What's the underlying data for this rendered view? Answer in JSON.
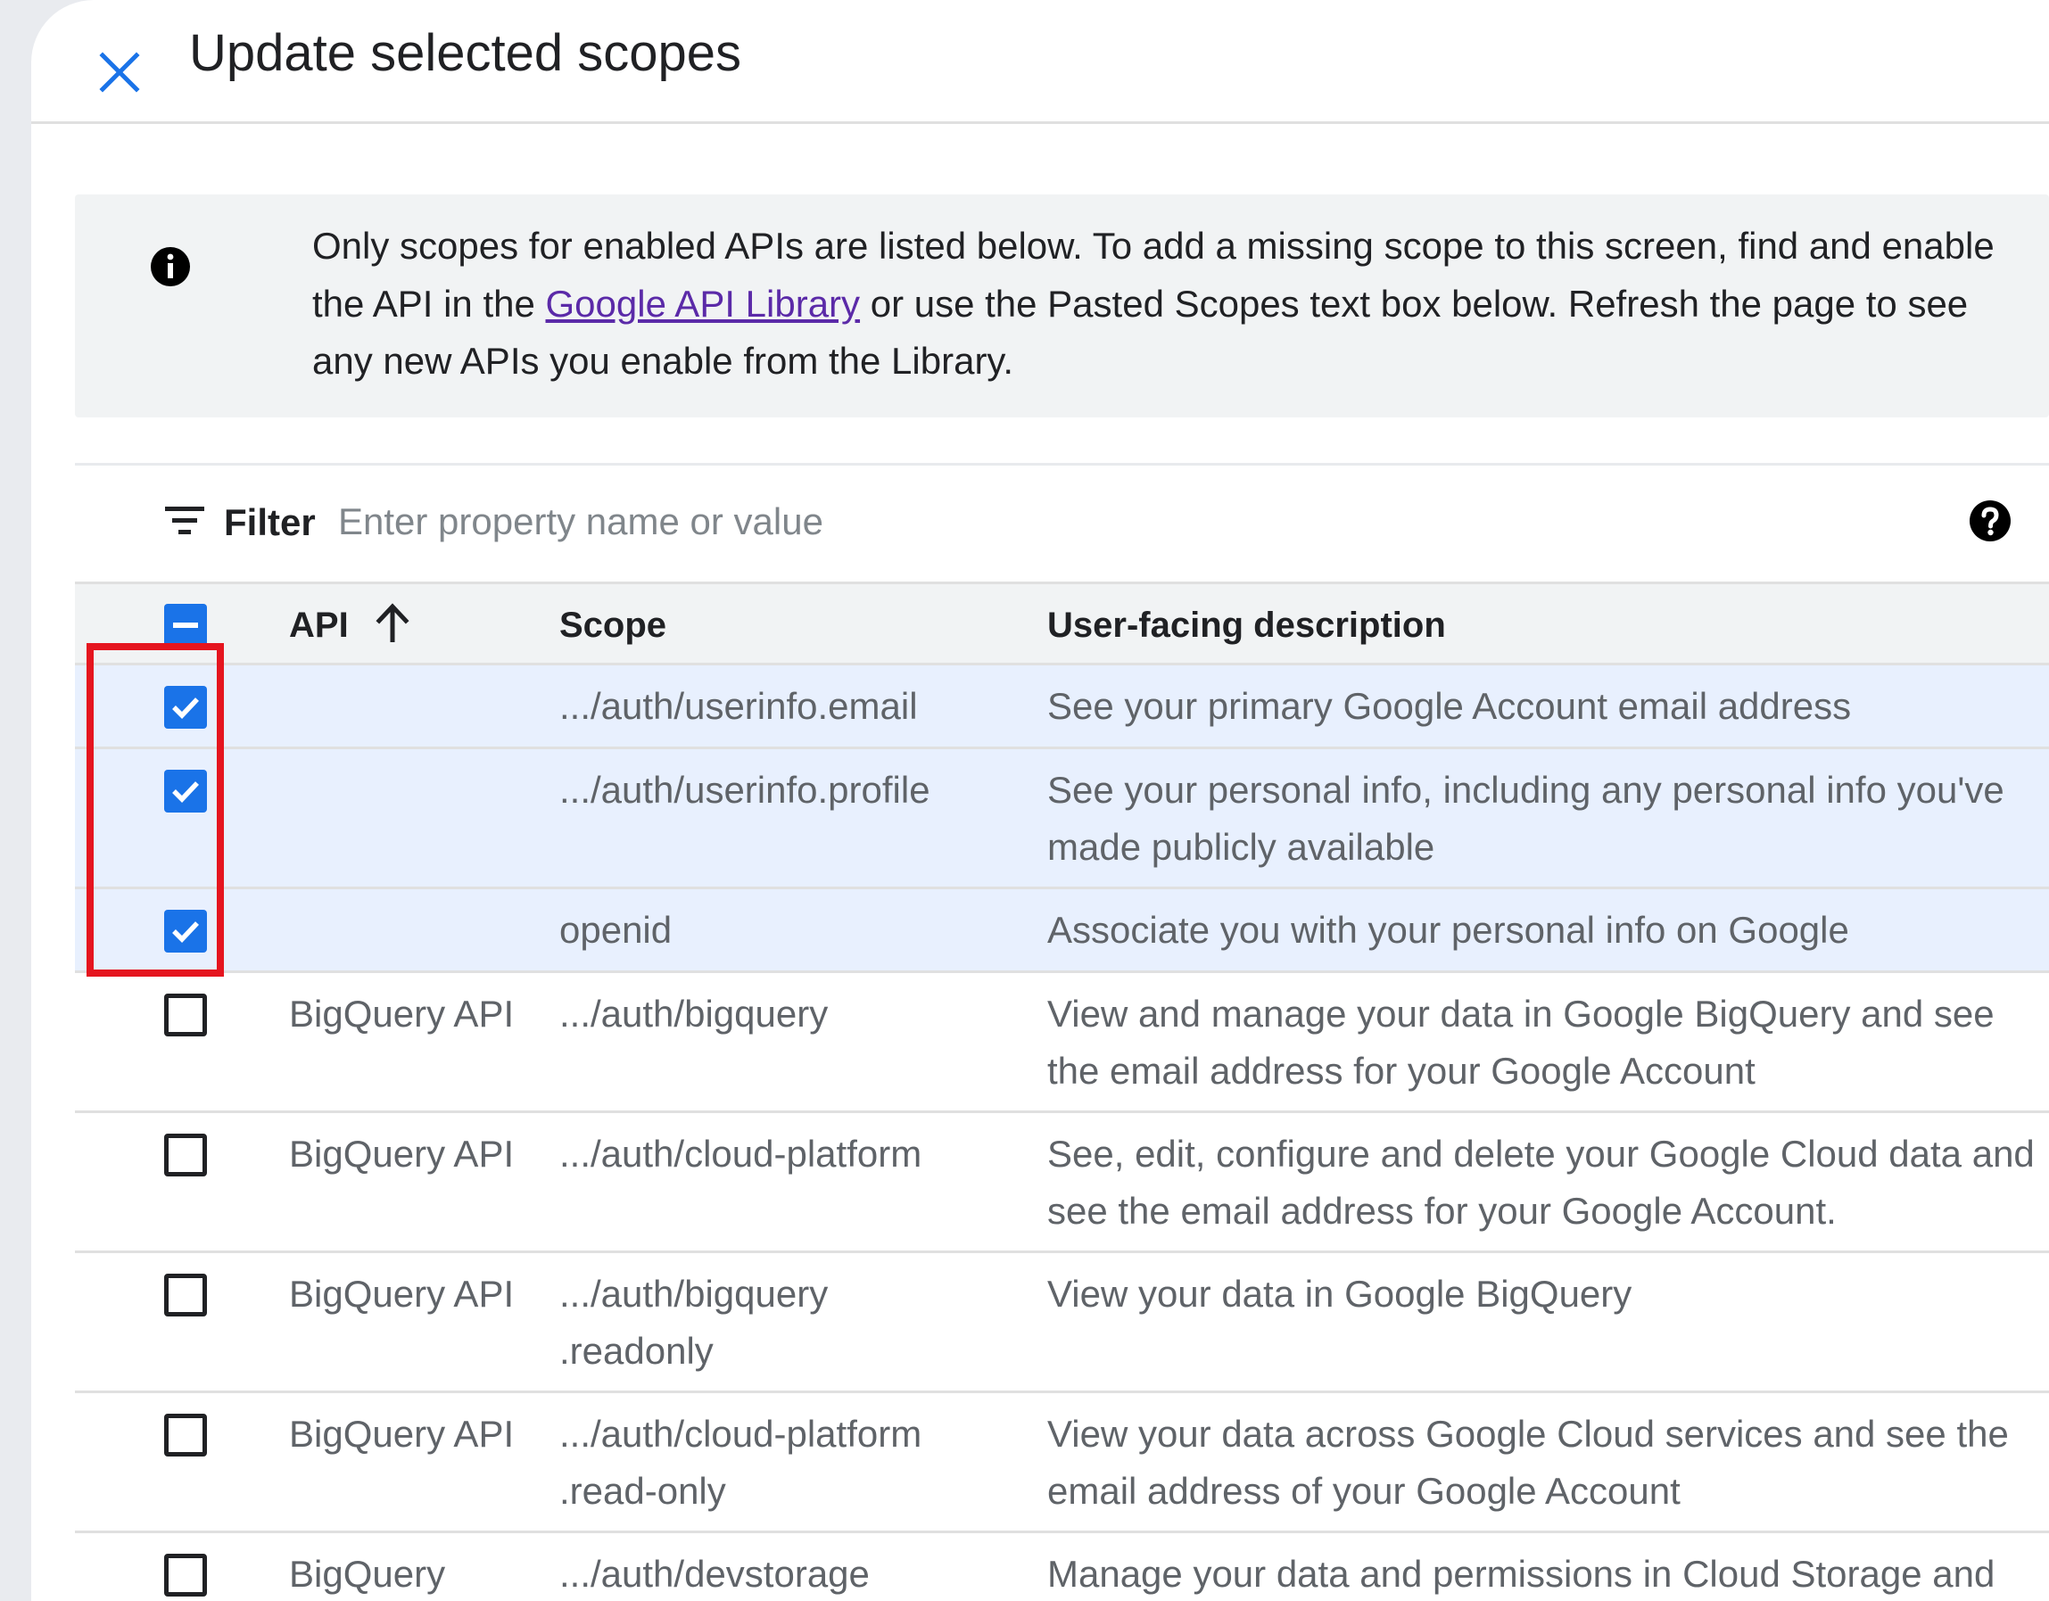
{
  "dialog": {
    "title": "Update selected scopes",
    "close_icon": "close-icon"
  },
  "banner": {
    "icon": "info-icon",
    "text_before": "Only scopes for enabled APIs are listed below. To add a missing scope to this screen, find and enable the API in the ",
    "link_text": "Google API Library",
    "text_after": " or use the Pasted Scopes text box below. Refresh the page to see any new APIs you enable from the Library."
  },
  "filter": {
    "icon": "filter-icon",
    "label": "Filter",
    "placeholder": "Enter property name or value",
    "value": "",
    "help_icon": "help-icon"
  },
  "table": {
    "header_checkbox_state": "indeterminate",
    "columns": {
      "api": "API",
      "api_sort": "ascending",
      "scope": "Scope",
      "description": "User-facing description"
    },
    "rows": [
      {
        "checked": true,
        "api": "",
        "scope": ".../auth/userinfo.email",
        "description": "See your primary Google Account email address"
      },
      {
        "checked": true,
        "api": "",
        "scope": ".../auth/userinfo.profile",
        "description": "See your personal info, including any personal info you've made publicly available"
      },
      {
        "checked": true,
        "api": "",
        "scope": "openid",
        "description": "Associate you with your personal info on Google"
      },
      {
        "checked": false,
        "api": "BigQuery API",
        "scope": ".../auth/bigquery",
        "description": "View and manage your data in Google BigQuery and see the email address for your Google Account"
      },
      {
        "checked": false,
        "api": "BigQuery API",
        "scope": ".../auth/cloud-platform",
        "description": "See, edit, configure and delete your Google Cloud data and see the email address for your Google Account."
      },
      {
        "checked": false,
        "api": "BigQuery API",
        "scope": ".../auth/bigquery .readonly",
        "description": "View your data in Google BigQuery"
      },
      {
        "checked": false,
        "api": "BigQuery API",
        "scope": ".../auth/cloud-platform .read-only",
        "description": "View your data across Google Cloud services and see the email address of your Google Account"
      },
      {
        "checked": false,
        "api": "BigQuery",
        "scope": ".../auth/devstorage",
        "description": "Manage your data and permissions in Cloud Storage and"
      }
    ]
  },
  "colors": {
    "accent": "#1a73e8",
    "highlight_box": "#e5151f",
    "selected_row": "#e8f0fe",
    "link": "#5b2aa8"
  }
}
